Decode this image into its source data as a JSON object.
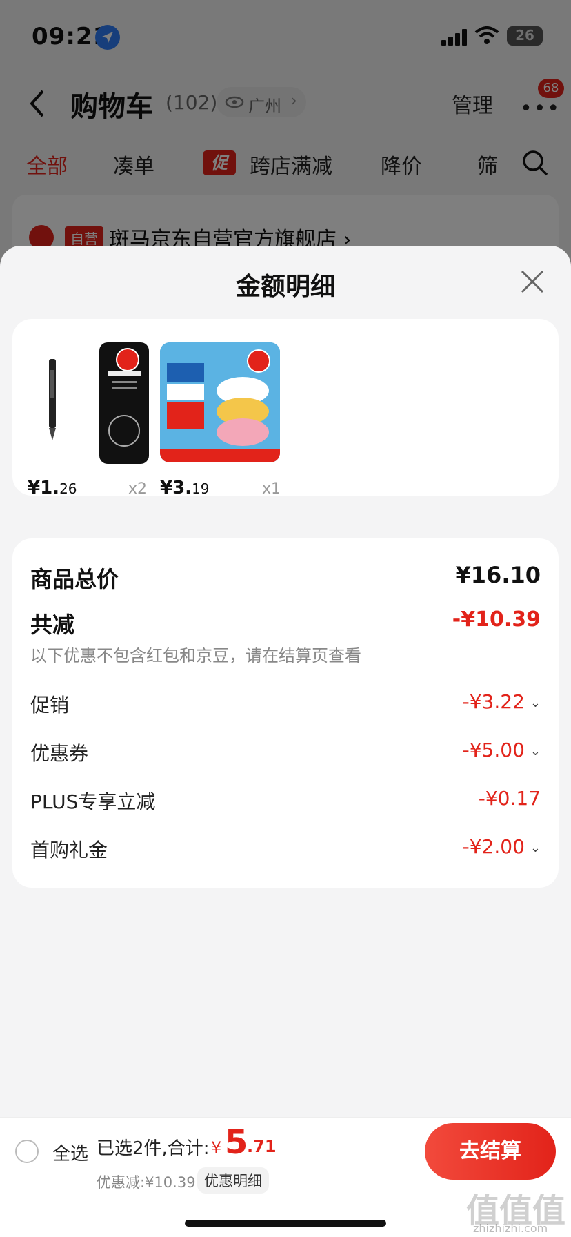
{
  "status_bar": {
    "time": "09:21",
    "battery": "26"
  },
  "nav": {
    "title": "购物车",
    "count": "(102)",
    "location": "广州",
    "manage": "管理",
    "badge": "68"
  },
  "filters": {
    "all": "全部",
    "bundle": "凑单",
    "promo_tag": "促",
    "cross_store": "跨店满减",
    "price_drop": "降价",
    "filter": "筛"
  },
  "store": {
    "tag": "自营",
    "name": "斑马京东自营官方旗舰店 ›"
  },
  "sheet": {
    "title": "金额明细",
    "products": [
      {
        "price_main": "¥1.",
        "price_cents": "26",
        "qty": "x2"
      },
      {
        "price_main": "¥3.",
        "price_cents": "19",
        "qty": "x1"
      }
    ],
    "total_label": "商品总价",
    "total_value": "¥16.10",
    "reduce_label": "共减",
    "reduce_value": "-¥10.39",
    "note": "以下优惠不包含红包和京豆，请在结算页查看",
    "rows": [
      {
        "label": "促销",
        "value": "-¥3.22"
      },
      {
        "label": "优惠券",
        "value": "-¥5.00"
      },
      {
        "label": "PLUS专享立减",
        "value": "-¥0.17"
      },
      {
        "label": "首购礼金",
        "value": "-¥2.00"
      }
    ]
  },
  "bottom": {
    "select_all": "全选",
    "selected": "已选2件,合计:",
    "currency": "¥",
    "total_int": "5",
    "total_dec": ".71",
    "discount": "优惠减:¥10.39",
    "detail_link": "优惠明细",
    "checkout": "去结算"
  },
  "colors": {
    "accent": "#e2231a",
    "sheet_bg": "#f4f4f5"
  }
}
